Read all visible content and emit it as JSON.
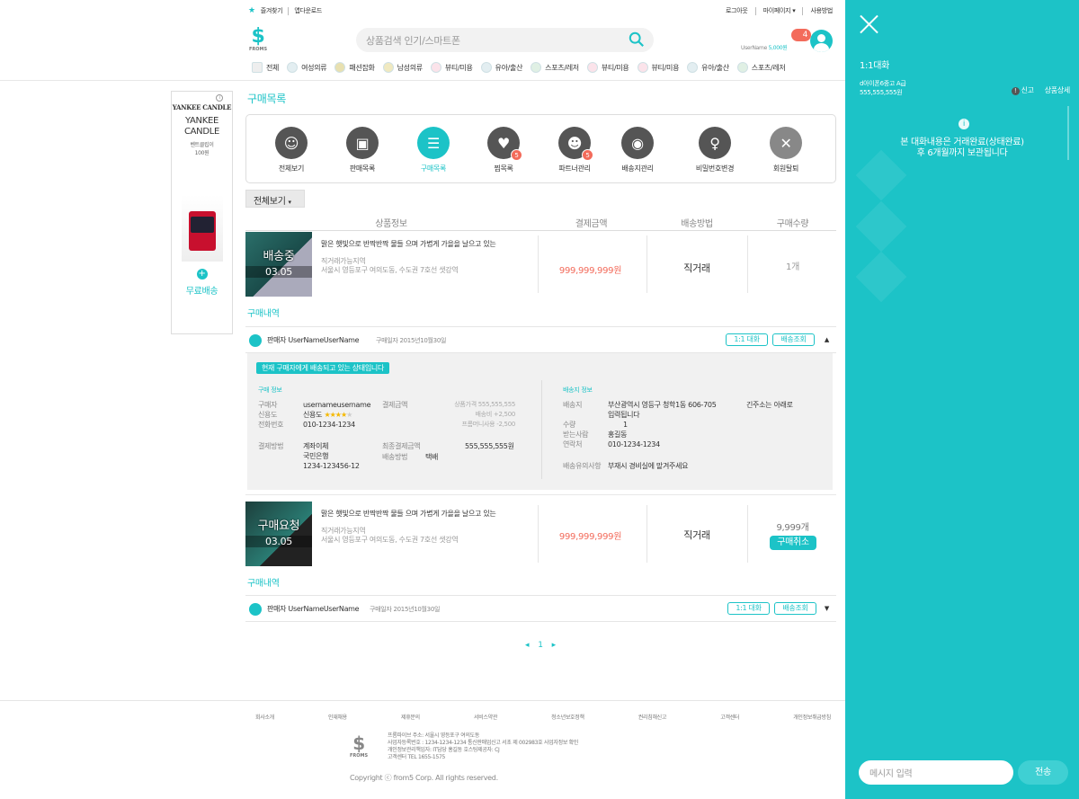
{
  "topbar": {
    "favorite": "즐겨찾기",
    "app_download": "앱다운로드",
    "logout": "로그아웃",
    "mypage": "마이페이지",
    "guide": "사용방법"
  },
  "logo": {
    "mark": "$",
    "text": "FROMS"
  },
  "search": {
    "placeholder": "상품검색 인기/스마트폰"
  },
  "user": {
    "name": "UserName",
    "points": "5,000원",
    "notifications": "4"
  },
  "categories": [
    "전체",
    "여성의류",
    "패션잡화",
    "남성의류",
    "뷰티/미용",
    "유아/출산",
    "스포츠/레저",
    "뷰티/미용",
    "뷰티/미용",
    "유아/출산",
    "스포츠/레저"
  ],
  "ad": {
    "brand": "YANKEE CANDLE",
    "brand_line": "YANKEE CANDLE",
    "desc1": "벤트클립이",
    "desc2": "100원",
    "free": "무료배송",
    "info": "i"
  },
  "page_title": "구매목록",
  "menu": [
    {
      "label": "전체보기"
    },
    {
      "label": "판매목록"
    },
    {
      "label": "구매목록"
    },
    {
      "label": "찜목록",
      "badge": "5"
    },
    {
      "label": "파트너관리",
      "badge": "5"
    },
    {
      "label": "배송지관리"
    },
    {
      "label": "비밀번호변경"
    },
    {
      "label": "회원탈퇴"
    }
  ],
  "filter": {
    "label": "전체보기"
  },
  "table_headers": {
    "product": "상품정보",
    "amount": "결제금액",
    "shipping": "배송방법",
    "qty": "구매수량"
  },
  "orders": [
    {
      "overlay": "배송중",
      "date": "03.05",
      "title": "맑은 햇빛으로 반짝반짝 물들 으며 가볍게 가을을 날으고 있는",
      "area_label": "직거래가능지역",
      "area": "서울시 영등포구 여의도동, 수도권 7호선 샛강역",
      "price": "999,999,999원",
      "shipping": "직거래",
      "qty": "1개",
      "section": "구매내역",
      "seller": "판매자 UserNameUserName",
      "purchase_date": "구매일자 2015년10월30일",
      "chat_btn": "1:1 대화",
      "track_btn": "배송조회",
      "caret": "▲"
    },
    {
      "overlay": "구매요청",
      "date": "03.05",
      "title": "맑은 햇빛으로 반짝반짝 물들 으며 가볍게 가을을 날으고 있는",
      "area_label": "직거래가능지역",
      "area": "서울시 영등포구 여의도동, 수도권 7호선 샛강역",
      "price": "999,999,999원",
      "shipping": "직거래",
      "qty": "9,999개",
      "cancel": "구매취소",
      "section": "구매내역",
      "seller": "판매자 UserNameUserName",
      "purchase_date": "구매일자 2015년10월30일",
      "chat_btn": "1:1 대화",
      "track_btn": "배송조회",
      "caret": "▼"
    }
  ],
  "detail": {
    "status": "현재 구매자에게 배송되고 있는 상태입니다",
    "buyer_head": "구매 정보",
    "buyer_id_label": "구매자",
    "buyer_id": "usernameusername",
    "credit_label": "신용도",
    "credit": "신용도",
    "stars": "★★★★",
    "star_empty": "★",
    "phone_label": "전화번호",
    "phone": "010-1234-1234",
    "pay_label": "결제금액",
    "goods_price": "상품가격 555,555,555",
    "ship_fee": "배송비 +2,500",
    "money_use": "프롬머니사용 -2,500",
    "method_label": "결제방법",
    "method": "계좌이체",
    "bank": "국민은행",
    "account": "1234-123456-12",
    "final_label": "최종결제금액",
    "final": "555,555,555원",
    "ship_method_label": "배송방법",
    "ship_method": "택배",
    "dest_head": "배송지 정보",
    "addr_label": "배송지",
    "addr1": "부산광역시 영등구 청학1동  606-705",
    "addr2": "입력됩니다",
    "addr_note": "긴주소는 아래로",
    "qty_label": "수량",
    "qty": "1",
    "receiver_label": "받는사람",
    "receiver": "홍길동",
    "contact_label": "연락처",
    "contact": "010-1234-1234",
    "note_label": "배송유의사항",
    "note": "부재시 경비실에 맡겨주세요"
  },
  "pager": {
    "prev": "◂",
    "page": "1",
    "next": "▸"
  },
  "footer": {
    "links": [
      "회사소개",
      "인재채용",
      "제휴문의",
      "서비스약관",
      "청소년보호정책",
      "권리침해신고",
      "고객센터",
      "개인정보취급방침"
    ],
    "info1": "프롬파이브 주소: 서울시 영등포구 여의도동",
    "info2": "사업자등록번호 : 1234-1234-1234 통신판매업신고 서초 제 002983호 사업자정보 확인",
    "info3": "개인정보관리책임자: IT담당 홍길동 호스팅제공자: CJ",
    "info4": "고객센터 TEL 1655-1575",
    "copyright": "Copyright ⓒ from5 Corp. All rights reserved."
  },
  "chat": {
    "title": "1:1대화",
    "product": "d아이폰6중고 A급",
    "product_price": "555,555,555원",
    "report": "신고",
    "product_detail": "상품상세",
    "notice1": "본 대화내용은 거래완료(상태완료)",
    "notice2": "후 6개월까지 보관됩니다",
    "placeholder": "메시지 입력",
    "send": "전송"
  }
}
